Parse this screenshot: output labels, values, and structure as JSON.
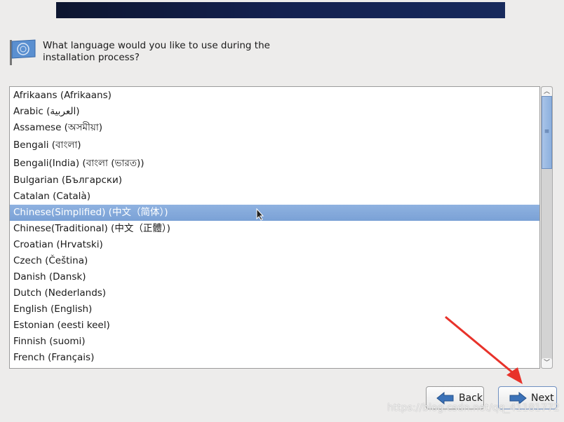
{
  "header": {
    "prompt": "What language would you like to use during the installation process?"
  },
  "languages": [
    "Afrikaans (Afrikaans)",
    "Arabic (العربية)",
    "Assamese (অসমীয়া)",
    "Bengali (বাংলা)",
    "Bengali(India) (বাংলা (ভারত))",
    "Bulgarian (Български)",
    "Catalan (Català)",
    "Chinese(Simplified) (中文（简体）)",
    "Chinese(Traditional) (中文（正體）)",
    "Croatian (Hrvatski)",
    "Czech (Čeština)",
    "Danish (Dansk)",
    "Dutch (Nederlands)",
    "English (English)",
    "Estonian (eesti keel)",
    "Finnish (suomi)",
    "French (Français)"
  ],
  "selected": "Chinese(Simplified) (中文（简体）)",
  "buttons": {
    "back": "Back",
    "next": "Next"
  },
  "watermark": "https://blog.csdn.net/qq_41181772"
}
